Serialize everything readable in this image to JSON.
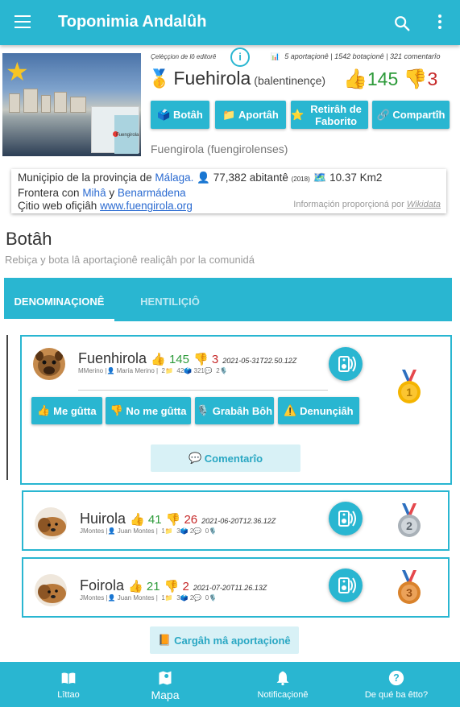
{
  "app": {
    "title": "Toponimia Andalûh"
  },
  "header": {
    "editors_label": "Çelèççion de lô editorê",
    "info_label": "i",
    "stats_text": "5 aportaçionê | 1542 botaçionê | 321 comentarîo",
    "place_name": "Fuehirola",
    "place_type": "(balentinençe)",
    "votes_up": "145",
    "votes_down": "3",
    "demonym": "Fuengirola (fuengirolenses)",
    "photo_map_label": "Fuengirola"
  },
  "actions": [
    {
      "label": "Botâh",
      "icon": "ballot-box-icon"
    },
    {
      "label": "Aportâh",
      "icon": "folder-icon"
    },
    {
      "label": "Retirâh de Faborito",
      "icon": "star-icon"
    },
    {
      "label": "Compartîh",
      "icon": "link-icon"
    }
  ],
  "wiki": {
    "line1_prefix": "Muniçipio de la provinçia de",
    "province": "Málaga.",
    "population": "77,382 abitantê",
    "population_year": "(2018)",
    "area": "10.37 Km2",
    "line2_prefix": "Frontera con",
    "border1": "Mihâ",
    "border_sep": "y",
    "border2": "Benarmádena",
    "web_label": "Çitio web ofiçiâh",
    "web_url": "www.fuengirola.org",
    "credit_prefix": "Informaçión proporçioná por",
    "credit_source": "Wikidata"
  },
  "section": {
    "title": "Botâh",
    "subtitle": "Rebiça y bota lâ aportaçionê realiçâh por la comunidá"
  },
  "tabs": [
    {
      "label": "DENOMINAÇIONÊ",
      "active": true
    },
    {
      "label": "HENTILIÇIÔ",
      "active": false
    }
  ],
  "entries": [
    {
      "name": "Fuenhirola",
      "up": "145",
      "down": "3",
      "date": "2021-05-31T22.50.12Z",
      "author_short": "MMerino",
      "author_full": "María Merino",
      "stat1": "2",
      "stat2": "42",
      "stat3": "321",
      "stat4": "2",
      "rank": "1",
      "buttons": {
        "like": "Me gûtta",
        "dislike": "No me gûtta",
        "record": "Grabâh Bôh",
        "report": "Denunçiâh",
        "comment": "Comentarîo"
      }
    },
    {
      "name": "Huirola",
      "up": "41",
      "down": "26",
      "date": "2021-06-20T12.36.12Z",
      "author_short": "JMontes",
      "author_full": "Juan Montes",
      "stat1": "1",
      "stat2": "3",
      "stat3": "2",
      "stat4": "0",
      "rank": "2"
    },
    {
      "name": "Foirola",
      "up": "21",
      "down": "2",
      "date": "2021-07-20T11.26.13Z",
      "author_short": "JMontes",
      "author_full": "Juan Montes",
      "stat1": "1",
      "stat2": "3",
      "stat3": "2",
      "stat4": "0",
      "rank": "3"
    }
  ],
  "load_more": "Cargâh mâ aportaçionê",
  "bottom_nav": [
    {
      "label": "Lîttao",
      "icon": "book-icon",
      "active": false
    },
    {
      "label": "Mapa",
      "icon": "map-icon",
      "active": true
    },
    {
      "label": "Notificaçionê",
      "icon": "bell-icon",
      "active": false
    },
    {
      "label": "De qué ba êtto?",
      "icon": "help-icon",
      "active": false
    }
  ],
  "colors": {
    "primary": "#29b6d1",
    "vote_up": "#2e9b3b",
    "vote_down": "#c62828",
    "link": "#2b6bd1"
  }
}
